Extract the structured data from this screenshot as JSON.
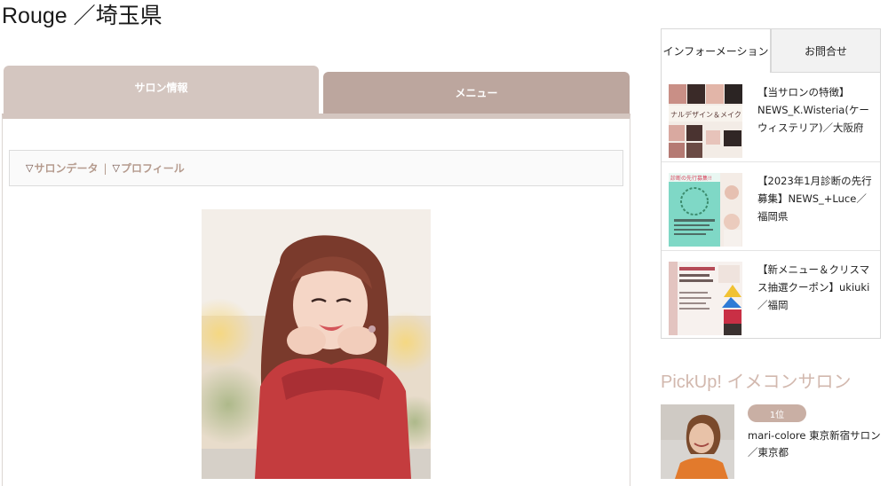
{
  "page": {
    "title": "Rouge ／埼玉県"
  },
  "tabs": {
    "salon_info": "サロン情報",
    "menu": "メニュー"
  },
  "anchors": {
    "marker": "▽",
    "salon_data": "サロンデータ",
    "separator": "|",
    "profile": "プロフィール"
  },
  "sidebar": {
    "tabs": {
      "info": "インフォーメーション",
      "contact": "お問合せ"
    },
    "news": [
      {
        "text": "【当サロンの特徴】NEWS_K.Wisteria(ケーウィステリア)／大阪府",
        "thumb_caption": "ナルデザイン＆メイクレ"
      },
      {
        "text": "【2023年1月診断の先行募集】NEWS_+Luce／福岡県",
        "thumb_caption": "診断の先行募集!!"
      },
      {
        "text": "【新メニュー＆クリスマス抽選クーポン】ukiuki／福岡",
        "thumb_caption": ""
      }
    ],
    "pickup": {
      "title": "PickUp! イメコンサロン",
      "rank": "1位",
      "name": "mari-colore 東京新宿サロン／東京都"
    }
  },
  "colors": {
    "tab_salon": "#d4c6c0",
    "tab_menu": "#bca69e",
    "anchor_text": "#b59b8e",
    "pickup_title": "#d2b8ae",
    "badge": "#c9afa4"
  }
}
